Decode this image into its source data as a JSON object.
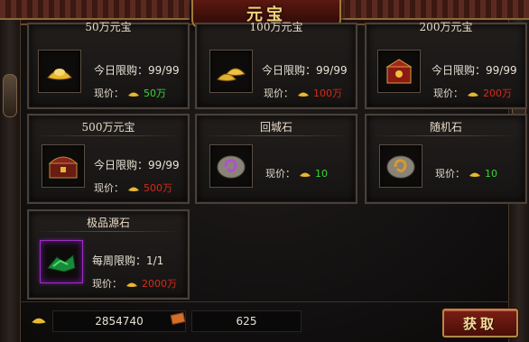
{
  "window": {
    "title": "元宝"
  },
  "shop": {
    "items": [
      {
        "name": "50万元宝",
        "limit": "今日限购：99/99",
        "price_label": "现价：",
        "price": "50万",
        "price_color": "#3ad43a",
        "icon": "gold-ingot-icon"
      },
      {
        "name": "100万元宝",
        "limit": "今日限购：99/99",
        "price_label": "现价：",
        "price": "100万",
        "price_color": "#d42a1a",
        "icon": "gold-stack-icon"
      },
      {
        "name": "200万元宝",
        "limit": "今日限购：99/99",
        "price_label": "现价：",
        "price": "200万",
        "price_color": "#d42a1a",
        "icon": "treasure-box-icon"
      },
      {
        "name": "500万元宝",
        "limit": "今日限购：99/99",
        "price_label": "现价：",
        "price": "500万",
        "price_color": "#d42a1a",
        "icon": "treasure-chest-icon"
      },
      {
        "name": "回城石",
        "limit": "",
        "price_label": "现价：",
        "price": "10",
        "price_color": "#3ad43a",
        "icon": "return-stone-icon"
      },
      {
        "name": "随机石",
        "limit": "",
        "price_label": "现价：",
        "price": "10",
        "price_color": "#3ad43a",
        "icon": "random-stone-icon"
      },
      {
        "name": "极品源石",
        "limit": "每周限购：1/1",
        "price_label": "现价：",
        "price": "2000万",
        "price_color": "#d42a1a",
        "icon": "jade-source-stone-icon"
      }
    ]
  },
  "footer": {
    "gold_amount": "2854740",
    "voucher_amount": "625",
    "claim_button": "获取"
  }
}
